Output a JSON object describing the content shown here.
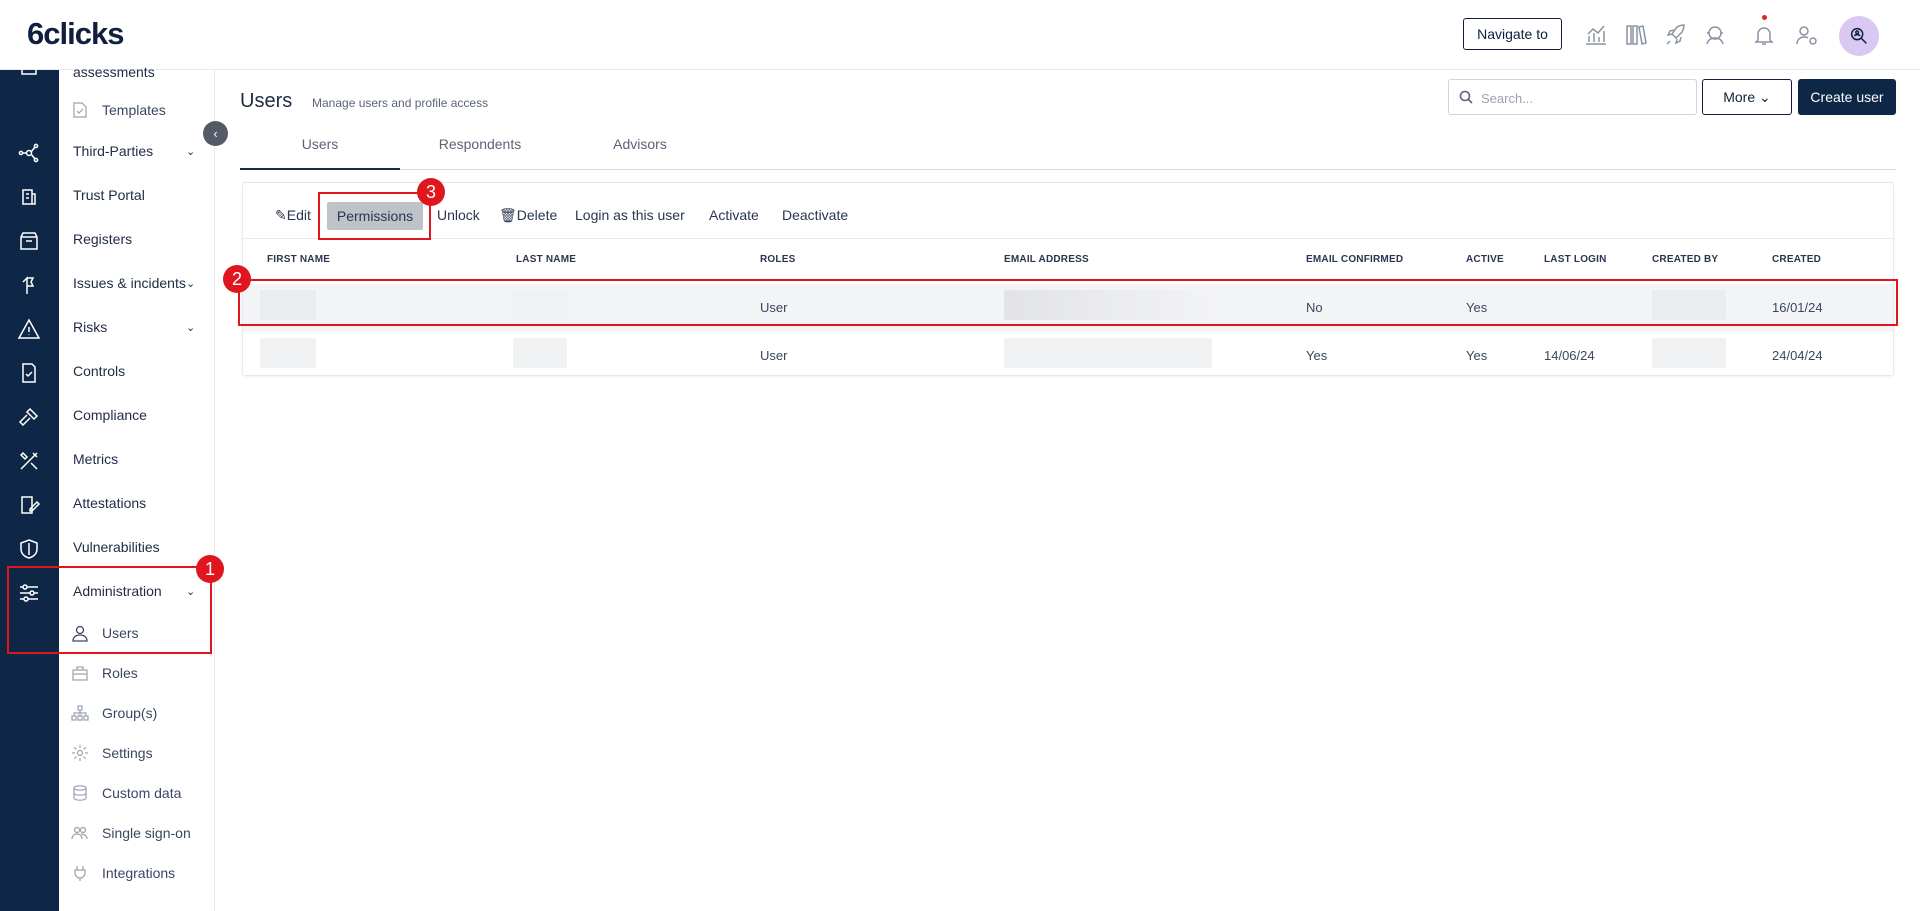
{
  "brand": {
    "logo": "6clicks"
  },
  "topbar": {
    "navigate_label": "Navigate to"
  },
  "sidebar": {
    "partial_label": "assessments",
    "templates": "Templates",
    "items": [
      {
        "label": "Third-Parties",
        "chevron": true
      },
      {
        "label": "Trust Portal",
        "chevron": false
      },
      {
        "label": "Registers",
        "chevron": false
      },
      {
        "label": "Issues & incidents",
        "chevron": true
      },
      {
        "label": "Risks",
        "chevron": true
      },
      {
        "label": "Controls",
        "chevron": false
      },
      {
        "label": "Compliance",
        "chevron": false
      },
      {
        "label": "Metrics",
        "chevron": false
      },
      {
        "label": "Attestations",
        "chevron": false
      },
      {
        "label": "Vulnerabilities",
        "chevron": false
      },
      {
        "label": "Administration",
        "chevron": true
      }
    ],
    "admin_sub": [
      {
        "label": "Users",
        "icon": "user-icon"
      },
      {
        "label": "Roles",
        "icon": "briefcase-icon"
      },
      {
        "label": "Group(s)",
        "icon": "hierarchy-icon"
      },
      {
        "label": "Settings",
        "icon": "gear-icon"
      },
      {
        "label": "Custom data",
        "icon": "database-icon"
      },
      {
        "label": "Single sign-on",
        "icon": "users-icon"
      },
      {
        "label": "Integrations",
        "icon": "plug-icon"
      }
    ]
  },
  "page": {
    "title": "Users",
    "subtitle": "Manage users and profile access",
    "search_placeholder": "Search...",
    "more_label": "More",
    "create_label": "Create user",
    "tabs": [
      "Users",
      "Respondents",
      "Advisors"
    ]
  },
  "toolbar": {
    "edit": "Edit",
    "permissions": "Permissions",
    "unlock": "Unlock",
    "delete": "Delete",
    "login_as": "Login as this user",
    "activate": "Activate",
    "deactivate": "Deactivate"
  },
  "table": {
    "headers": [
      "FIRST NAME",
      "LAST NAME",
      "ROLES",
      "EMAIL ADDRESS",
      "EMAIL CONFIRMED",
      "ACTIVE",
      "LAST LOGIN",
      "CREATED BY",
      "CREATED"
    ],
    "rows": [
      {
        "roles": "User",
        "email_confirmed": "No",
        "active": "Yes",
        "last_login": "",
        "created": "16/01/24"
      },
      {
        "roles": "User",
        "email_confirmed": "Yes",
        "active": "Yes",
        "last_login": "14/06/24",
        "created": "24/04/24"
      }
    ]
  },
  "annotations": [
    "1",
    "2",
    "3"
  ],
  "colors": {
    "rail": "#0f2747",
    "accent_red": "#e0161f",
    "primary": "#0f2747"
  }
}
